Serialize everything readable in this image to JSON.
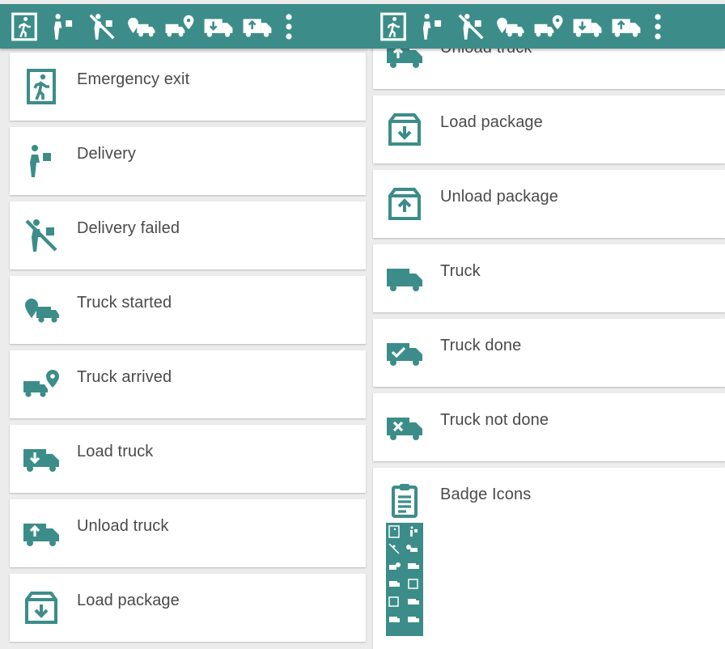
{
  "theme": {
    "accent": "#3c8d89",
    "card_bg": "#ffffff",
    "text": "#4a4a4a",
    "background": "#ececec"
  },
  "toolbar": {
    "icons": [
      "emergency-exit-icon",
      "delivery-icon",
      "delivery-failed-icon",
      "truck-started-icon",
      "truck-arrived-icon",
      "load-truck-icon",
      "unload-truck-icon",
      "more-vert-icon"
    ]
  },
  "left_list": [
    {
      "label": "Emergency exit",
      "icon": "emergency-exit-icon"
    },
    {
      "label": "Delivery",
      "icon": "delivery-icon"
    },
    {
      "label": "Delivery failed",
      "icon": "delivery-failed-icon"
    },
    {
      "label": "Truck started",
      "icon": "truck-started-icon"
    },
    {
      "label": "Truck arrived",
      "icon": "truck-arrived-icon"
    },
    {
      "label": "Load truck",
      "icon": "load-truck-icon"
    },
    {
      "label": "Unload truck",
      "icon": "unload-truck-icon"
    },
    {
      "label": "Load package",
      "icon": "load-package-icon"
    }
  ],
  "right_list": [
    {
      "label": "Unload truck",
      "icon": "unload-truck-icon"
    },
    {
      "label": "Load package",
      "icon": "load-package-icon"
    },
    {
      "label": "Unload package",
      "icon": "unload-package-icon"
    },
    {
      "label": "Truck",
      "icon": "truck-icon"
    },
    {
      "label": "Truck done",
      "icon": "truck-done-icon"
    },
    {
      "label": "Truck not done",
      "icon": "truck-not-done-icon"
    },
    {
      "label": "Badge Icons",
      "icon": "clipboard-icon"
    }
  ]
}
